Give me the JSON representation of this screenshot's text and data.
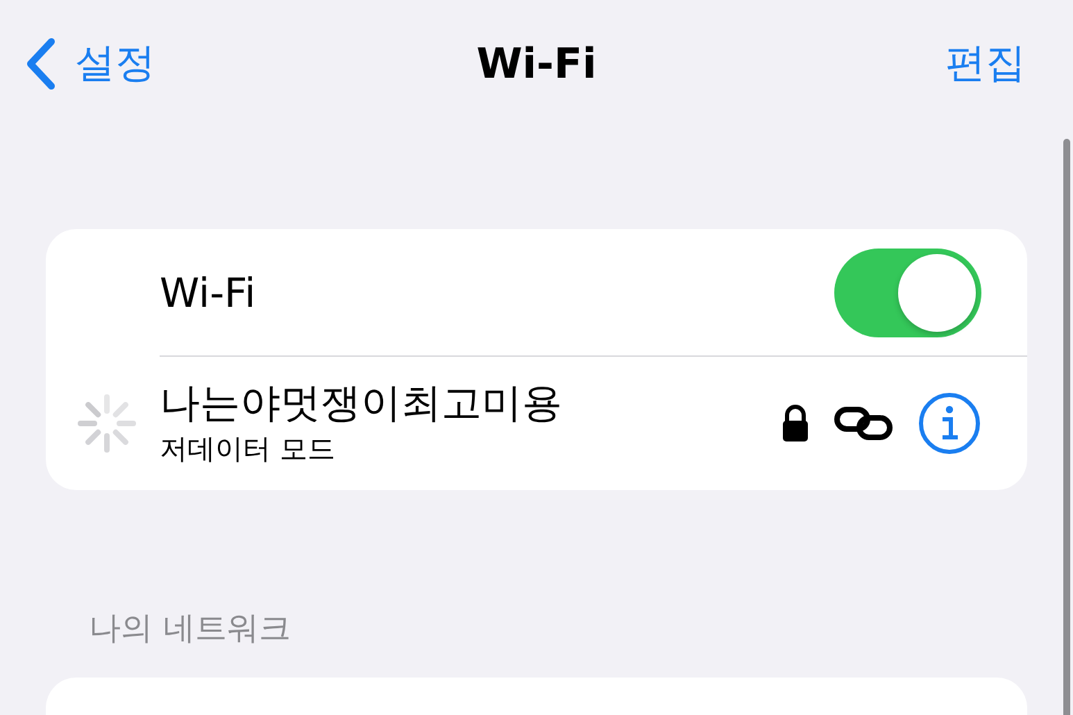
{
  "nav": {
    "back": "설정",
    "title": "Wi-Fi",
    "action": "편집"
  },
  "wifi": {
    "label": "Wi-Fi",
    "on": true
  },
  "current_network": {
    "name": "나는야멋쟁이최고미용",
    "subtitle": "저데이터 모드",
    "connecting": true,
    "secured": true
  },
  "my_networks": {
    "header": "나의 네트워크"
  }
}
